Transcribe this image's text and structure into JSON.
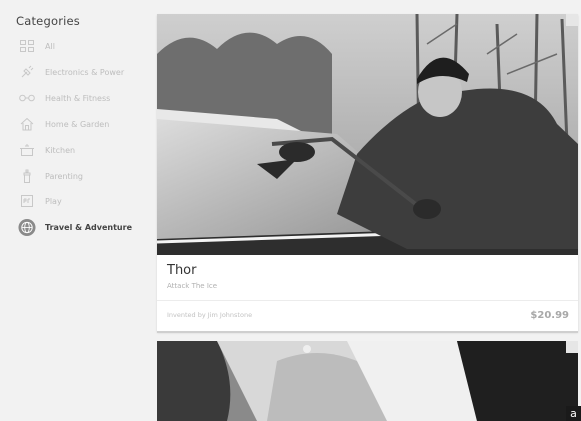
{
  "sidebar": {
    "title": "Categories",
    "items": [
      {
        "label": "All",
        "icon": "grid-icon",
        "active": false
      },
      {
        "label": "Electronics & Power",
        "icon": "plug-icon",
        "active": false
      },
      {
        "label": "Health & Fitness",
        "icon": "dumbbell-icon",
        "active": false
      },
      {
        "label": "Home & Garden",
        "icon": "house-icon",
        "active": false
      },
      {
        "label": "Kitchen",
        "icon": "pot-icon",
        "active": false
      },
      {
        "label": "Parenting",
        "icon": "baby-bottle-icon",
        "active": false
      },
      {
        "label": "Play",
        "icon": "game-icon",
        "active": false
      },
      {
        "label": "Travel & Adventure",
        "icon": "globe-icon",
        "active": true
      }
    ]
  },
  "products": [
    {
      "title": "Thor",
      "subtitle": "Attack The Ice",
      "inventor": "Invented by Jim Johnstone",
      "price": "$20.99",
      "image": "man scraping ice off car windshield"
    }
  ],
  "corner_mark": "a",
  "colors": {
    "background": "#f2f2f2",
    "card": "#ffffff",
    "active_icon": "#8a8a8a",
    "inactive_text": "#bdbdbd"
  }
}
